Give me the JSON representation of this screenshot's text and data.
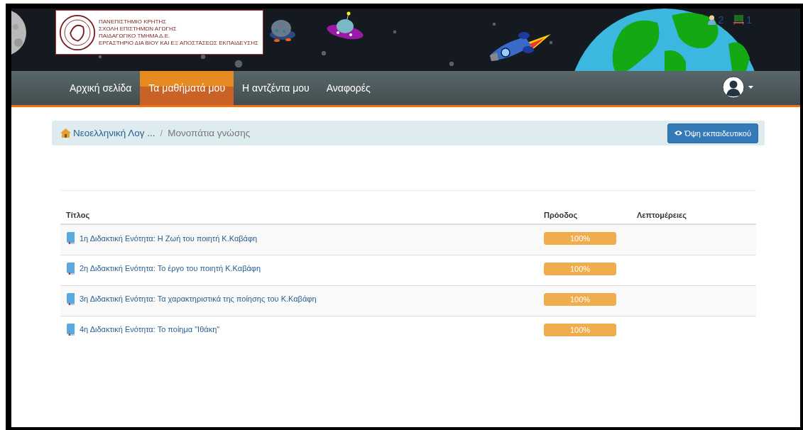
{
  "logo": {
    "lines": [
      "ΠΑΝΕΠΙΣΤΗΜΙΟ ΚΡΗΤΗΣ",
      "ΣΧΟΛΗ ΕΠΙΣΤΗΜΩΝ ΑΓΩΓΗΣ",
      "ΠΑΙΔΑΓΩΓΙΚΟ ΤΜΗΜΑ Δ.Ε.",
      "ΕΡΓΑΣΤΗΡΙΟ ΔΙΑ ΒΙΟΥ ΚΑΙ ΕΞ ΑΠΟΣΤΑΣΕΩΣ ΕΚΠΑΙΔΕΥΣΗΣ"
    ]
  },
  "counters": [
    {
      "kind": "users",
      "value": "2"
    },
    {
      "kind": "classroom",
      "value": "1"
    }
  ],
  "nav": [
    {
      "label": "Αρχική σελίδα",
      "selected": false
    },
    {
      "label": "Τα μαθήματά μου",
      "selected": true
    },
    {
      "label": "Η αντζέντα μου",
      "selected": false
    },
    {
      "label": "Αναφορές",
      "selected": false
    }
  ],
  "breadcrumb": [
    "Νεοελληνική Λογ ...",
    "Μονοπάτια γνώσης"
  ],
  "breadcrumb_separator": "/",
  "teacher_view_button": "Όψη εκπαιδευτικού",
  "table": {
    "columns": [
      "Τίτλος",
      "Πρόοδος",
      "Λεπτομέρειες"
    ],
    "rows": [
      {
        "title": "1η Διδακτική Ενότητα: Η Ζωή του ποιητή Κ.Καβάφη",
        "progress": {
          "level": 1,
          "reading": "100%"
        }
      },
      {
        "title": "2η Διδακτική Ενότητα: Το έργο του ποιητή Κ.Καβάφη",
        "progress": {
          "level": 1,
          "reading": "100%"
        }
      },
      {
        "title": "3η Διδακτική Ενότητα: Τα χαρακτηριστικά της ποίησης του Κ.Καβάφη",
        "progress": {
          "level": 1,
          "reading": "100%"
        }
      },
      {
        "title": "4η Διδακτική Ενότητα: Το ποίημα \"Ιθάκη\"",
        "progress": {
          "level": 1,
          "reading": "100%"
        }
      }
    ]
  }
}
